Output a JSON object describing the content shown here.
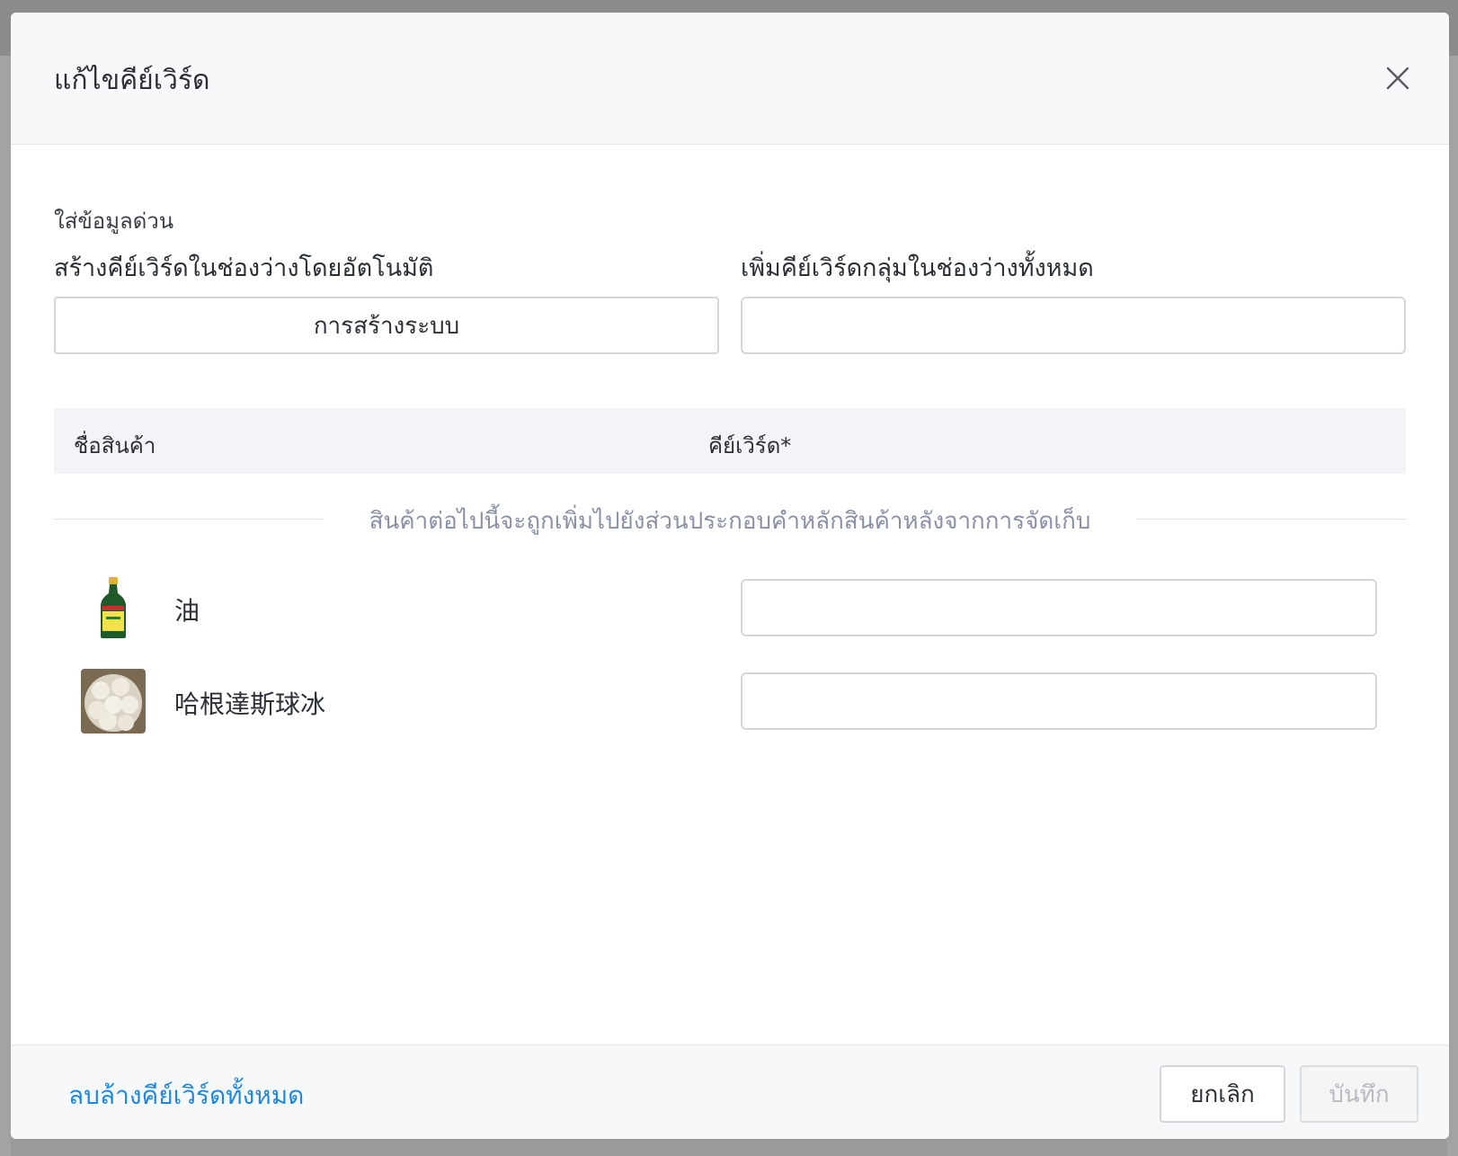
{
  "modal": {
    "title": "แก้ไขคีย์เวิร์ด",
    "close_icon": "close-icon"
  },
  "quick_fill": {
    "section_label": "ใส่ข้อมูลด่วน",
    "auto_label": "สร้างคีย์เวิร์ดในช่องว่างโดยอัตโนมัติ",
    "auto_button": "การสร้างระบบ",
    "batch_label": "เพิ่มคีย์เวิร์ดกลุ่มในช่องว่างทั้งหมด",
    "batch_value": ""
  },
  "table": {
    "headers": [
      "ชื่อสินค้า",
      "คีย์เวิร์ด*"
    ],
    "notice": "สินค้าต่อไปนี้จะถูกเพิ่มไปยังส่วนประกอบคำหลักสินค้าหลังจากการจัดเก็บ",
    "rows": [
      {
        "name": "油",
        "thumbnail": "oil-bottle-image",
        "keyword": ""
      },
      {
        "name": "哈根達斯球冰",
        "thumbnail": "dumplings-image",
        "keyword": ""
      }
    ]
  },
  "footer": {
    "clear_all": "ลบล้างคีย์เวิร์ดทั้งหมด",
    "cancel": "ยกเลิก",
    "save": "บันทึก"
  },
  "colors": {
    "link": "#1e88e5",
    "border": "#d4d6dc",
    "header_bg": "#f7f8fa",
    "notice_text": "#8a90a6"
  }
}
